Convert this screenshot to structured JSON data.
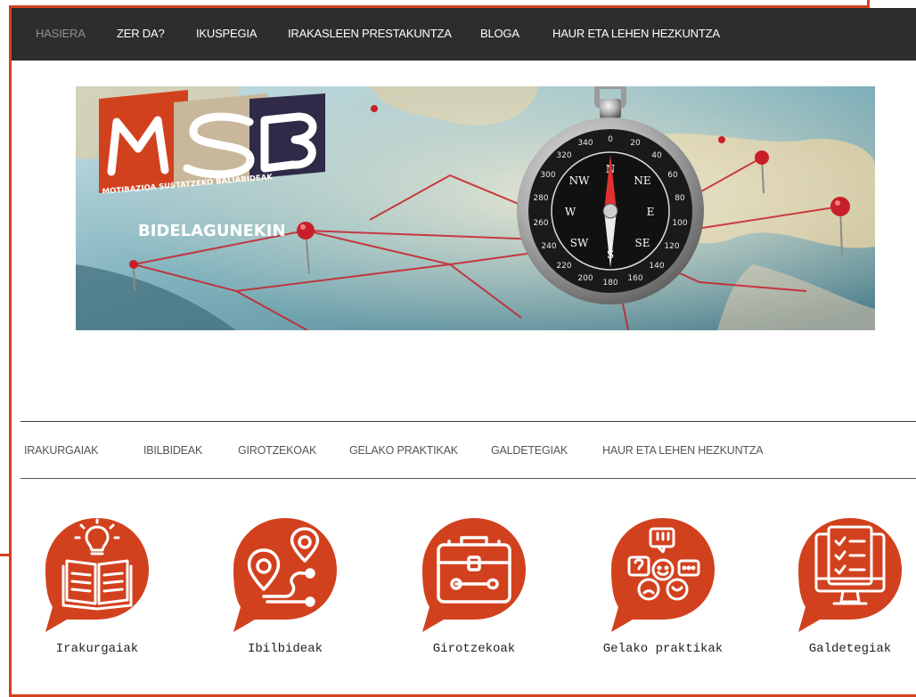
{
  "top_nav": {
    "items": [
      {
        "label": "HASIERA",
        "active": true
      },
      {
        "label": "ZER DA?"
      },
      {
        "label": "IKUSPEGIA"
      },
      {
        "label": "IRAKASLEEN PRESTAKUNTZA"
      },
      {
        "label": "BLOGA"
      },
      {
        "label": "HAUR ETA LEHEN HEZKUNTZA"
      }
    ]
  },
  "banner": {
    "logo_letters": "MSB",
    "logo_subtitle": "MOTIBAZIOA SUSTATZEKO BALIABIDEAK",
    "tagline": "BIDELAGUNEKIN",
    "compass": {
      "directions": [
        "N",
        "NE",
        "E",
        "SE",
        "S",
        "SW",
        "W",
        "NW"
      ],
      "degrees": [
        "0",
        "20",
        "40",
        "60",
        "80",
        "100",
        "120",
        "140",
        "160",
        "180",
        "200",
        "220",
        "240",
        "260",
        "280",
        "300",
        "320",
        "340"
      ]
    }
  },
  "sub_nav": {
    "items": [
      {
        "label": "IRAKURGAIAK"
      },
      {
        "label": "IBILBIDEAK"
      },
      {
        "label": "GIROTZEKOAK"
      },
      {
        "label": "GELAKO PRAKTIKAK"
      },
      {
        "label": "GALDETEGIAK"
      },
      {
        "label": "HAUR ETA LEHEN HEZKUNTZA"
      }
    ]
  },
  "tiles": [
    {
      "label": "Irakurgaiak",
      "icon": "book-lightbulb-icon"
    },
    {
      "label": "Ibilbideak",
      "icon": "route-pins-icon"
    },
    {
      "label": "Girotzekoak",
      "icon": "toolbox-icon"
    },
    {
      "label": "Gelako praktikak",
      "icon": "speech-faces-icon"
    },
    {
      "label": "Galdetegiak",
      "icon": "checklist-monitor-icon"
    }
  ],
  "colors": {
    "accent": "#d2411e",
    "nav_bg": "#2c2d2d",
    "nav_active": "#8f8f8f"
  }
}
